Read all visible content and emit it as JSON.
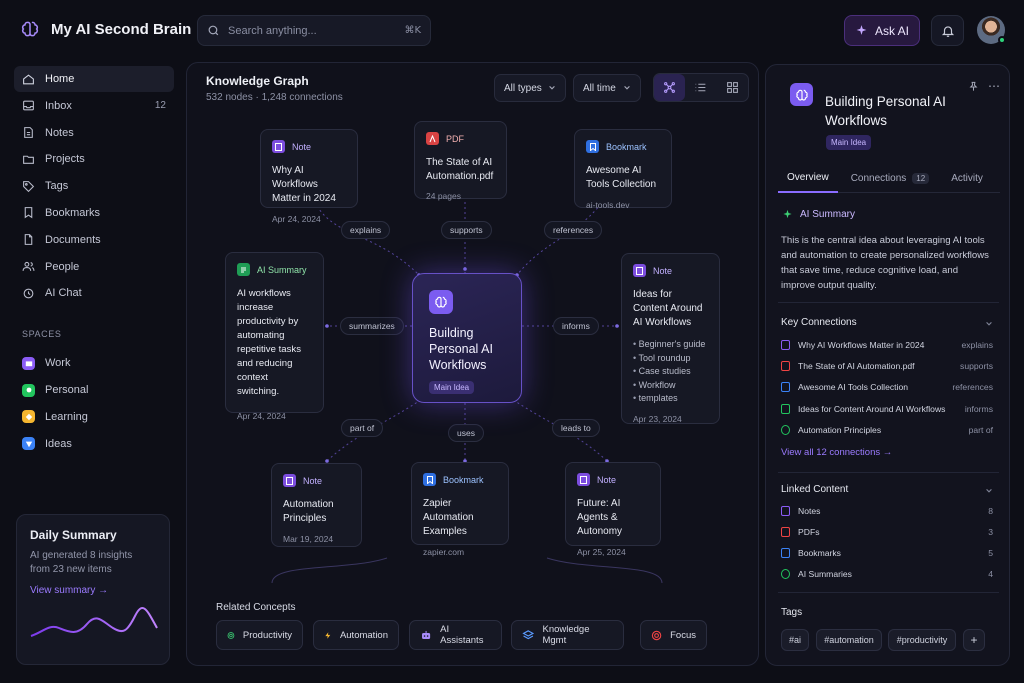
{
  "app": {
    "title": "My AI Second Brain"
  },
  "search": {
    "placeholder": "Search anything...",
    "shortcut": "⌘K"
  },
  "header": {
    "ask_ai_label": "Ask AI"
  },
  "sidebar": {
    "items": [
      {
        "label": "Home",
        "icon": "home-icon",
        "active": true
      },
      {
        "label": "Inbox",
        "icon": "inbox-icon",
        "count": "12"
      },
      {
        "label": "Notes",
        "icon": "note-icon"
      },
      {
        "label": "Projects",
        "icon": "folder-icon"
      },
      {
        "label": "Tags",
        "icon": "tag-icon"
      },
      {
        "label": "Bookmarks",
        "icon": "bookmark-icon"
      },
      {
        "label": "Documents",
        "icon": "document-icon"
      },
      {
        "label": "People",
        "icon": "people-icon"
      },
      {
        "label": "AI Chat",
        "icon": "ai-chat-icon"
      }
    ],
    "spaces_label": "SPACES",
    "spaces": [
      {
        "label": "Work",
        "color": "#8b5cf6"
      },
      {
        "label": "Personal",
        "color": "#22c55e"
      },
      {
        "label": "Learning",
        "color": "#f5b630"
      },
      {
        "label": "Ideas",
        "color": "#3b82f6"
      }
    ],
    "daily_summary": {
      "title": "Daily Summary",
      "text": "AI generated 8 insights from 23 new items",
      "link": "View summary →"
    }
  },
  "graph": {
    "title": "Knowledge Graph",
    "subtitle": "532 nodes · 1,248 connections",
    "filter_type": "All types",
    "filter_time": "All time",
    "central": {
      "title": "Building Personal AI Workflows",
      "tag": "Main Idea"
    },
    "nodes": [
      {
        "type": "Note",
        "title": "Why AI Workflows Matter in 2024",
        "meta": "Apr 24, 2024"
      },
      {
        "type": "PDF",
        "title": "The State of AI Automation.pdf",
        "meta": "24 pages"
      },
      {
        "type": "Bookmark",
        "title": "Awesome AI Tools Collection",
        "meta": "ai-tools.dev"
      },
      {
        "type": "AI Summary",
        "title": "AI workflows increase productivity by automating repetitive tasks and reducing context switching.",
        "meta": "Apr 24, 2024"
      },
      {
        "type": "Note",
        "title": "Ideas for Content Around AI Workflows",
        "bullets": [
          "Beginner's guide",
          "Tool roundup",
          "Case studies",
          "Workflow",
          "templates"
        ],
        "meta": "Apr 23, 2024"
      },
      {
        "type": "Note",
        "title": "Automation Principles",
        "meta": "Mar 19, 2024"
      },
      {
        "type": "Bookmark",
        "title": "Zapier Automation Examples",
        "meta": "zapier.com"
      },
      {
        "type": "Note",
        "title": "Future: AI Agents & Autonomy",
        "meta": "Apr 25, 2024"
      }
    ],
    "edge_labels": [
      "explains",
      "supports",
      "references",
      "summarizes",
      "informs",
      "part of",
      "uses",
      "leads to"
    ],
    "related_title": "Related Concepts",
    "related": [
      "Productivity",
      "Automation",
      "AI Assistants",
      "Knowledge Mgmt",
      "Focus"
    ]
  },
  "detail": {
    "title": "Building Personal AI Workflows",
    "tag": "Main Idea",
    "tabs": [
      {
        "label": "Overview",
        "active": true
      },
      {
        "label": "Connections",
        "count": "12"
      },
      {
        "label": "Activity"
      }
    ],
    "ai_summary_label": "AI Summary",
    "ai_summary_text": "This is the central idea about leveraging AI tools and automation to create personalized workflows that save time, reduce cognitive load, and improve output quality.",
    "key_connections_title": "Key Connections",
    "key_connections": [
      {
        "label": "Why AI Workflows Matter in 2024",
        "rel": "explains",
        "color": "#8b5cf6"
      },
      {
        "label": "The State of AI Automation.pdf",
        "rel": "supports",
        "color": "#ef4444"
      },
      {
        "label": "Awesome AI Tools Collection",
        "rel": "references",
        "color": "#3b82f6"
      },
      {
        "label": "Ideas for Content Around AI Workflows",
        "rel": "informs",
        "color": "#22c55e"
      },
      {
        "label": "Automation Principles",
        "rel": "part of",
        "color": "#22c55e"
      }
    ],
    "view_all": "View all 12 connections →",
    "linked_title": "Linked Content",
    "linked": [
      {
        "label": "Notes",
        "count": "8",
        "color": "#8b5cf6"
      },
      {
        "label": "PDFs",
        "count": "3",
        "color": "#ef4444"
      },
      {
        "label": "Bookmarks",
        "count": "5",
        "color": "#3b82f6"
      },
      {
        "label": "AI Summaries",
        "count": "4",
        "color": "#22c55e"
      }
    ],
    "tags_title": "Tags",
    "tags": [
      "#ai",
      "#automation",
      "#productivity"
    ],
    "add_tag": "+"
  }
}
